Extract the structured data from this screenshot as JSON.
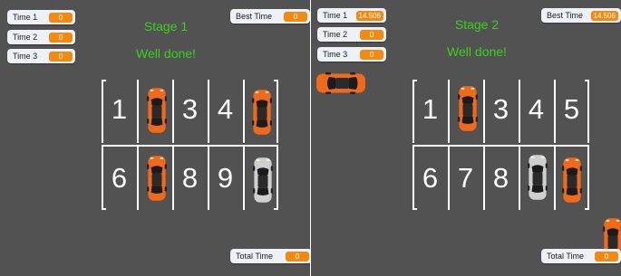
{
  "colors": {
    "ground": "#525252",
    "car_orange": "#f06a1c",
    "car_white": "#cfcfcf",
    "stage_text": "#37d11a",
    "hud_value": "#f38a10"
  },
  "stage1": {
    "title": "Stage 1",
    "message": "Well done!",
    "times": [
      {
        "label": "Time 1",
        "value": "0"
      },
      {
        "label": "Time 2",
        "value": "0"
      },
      {
        "label": "Time 3",
        "value": "0"
      }
    ],
    "best_time": {
      "label": "Best Time",
      "value": "0"
    },
    "total_time": {
      "label": "Total Time",
      "value": "0"
    },
    "spot_numbers": [
      "1",
      "3",
      "4",
      "6",
      "8",
      "9",
      "1"
    ]
  },
  "stage2": {
    "title": "Stage 2",
    "message": "Well done!",
    "times": [
      {
        "label": "Time 1",
        "value": "14.506"
      },
      {
        "label": "Time 2",
        "value": "0"
      },
      {
        "label": "Time 3",
        "value": "0"
      }
    ],
    "best_time": {
      "label": "Best Time",
      "value": "14.506"
    },
    "total_time": {
      "label": "Total Time",
      "value": "0"
    },
    "spot_numbers": [
      "1",
      "3",
      "4",
      "5",
      "6",
      "7",
      "8",
      "1"
    ]
  }
}
